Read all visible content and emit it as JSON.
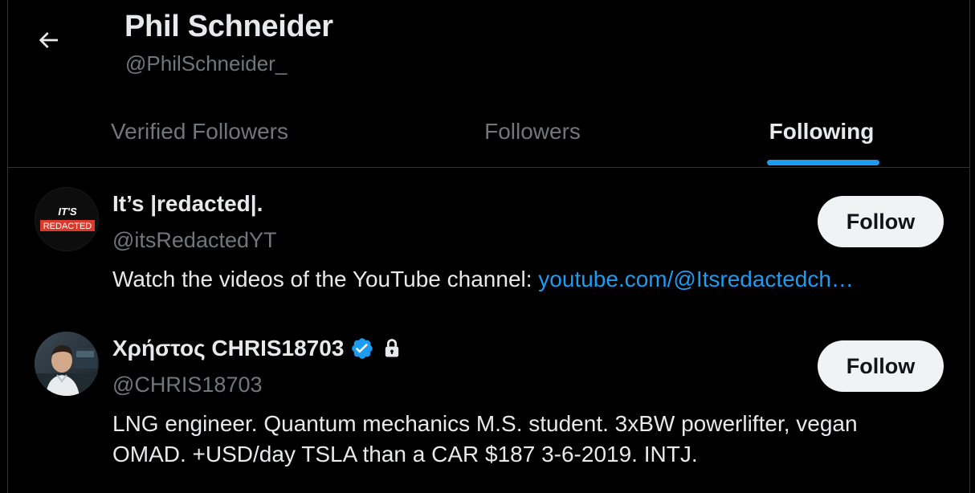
{
  "header": {
    "title": "Phil Schneider",
    "handle": "@PhilSchneider_"
  },
  "tabs": [
    {
      "label": "Verified Followers",
      "active": false
    },
    {
      "label": "Followers",
      "active": false
    },
    {
      "label": "Following",
      "active": true
    }
  ],
  "users": [
    {
      "name": "It’s |redacted|.",
      "handle": "@itsRedactedYT",
      "bio_text": "Watch the videos of the YouTube channel: ",
      "bio_link": "youtube.com/@Itsredactedch…",
      "avatar_text_top": "IT'S",
      "avatar_text_bottom": "REDACTED",
      "follow_label": "Follow",
      "verified": false,
      "protected": false
    },
    {
      "name": "Χρήστος CHRIS18703",
      "handle": "@CHRIS18703",
      "bio_line1": "LNG engineer. Quantum mechanics M.S. student. 3xBW powerlifter, vegan",
      "bio_line2": "OMAD. +USD/day TSLA than a CAR $187 3-6-2019. INTJ.",
      "follow_label": "Follow",
      "verified": true,
      "protected": true
    }
  ],
  "colors": {
    "background": "#000000",
    "accent": "#1d9bf0",
    "text_primary": "#e7e9ea",
    "text_secondary": "#71767b",
    "divider": "#2f3336",
    "redacted_red": "#d93a2b"
  },
  "icons": {
    "back": "back-arrow-icon",
    "verified": "verified-badge-icon",
    "protected": "lock-icon"
  }
}
